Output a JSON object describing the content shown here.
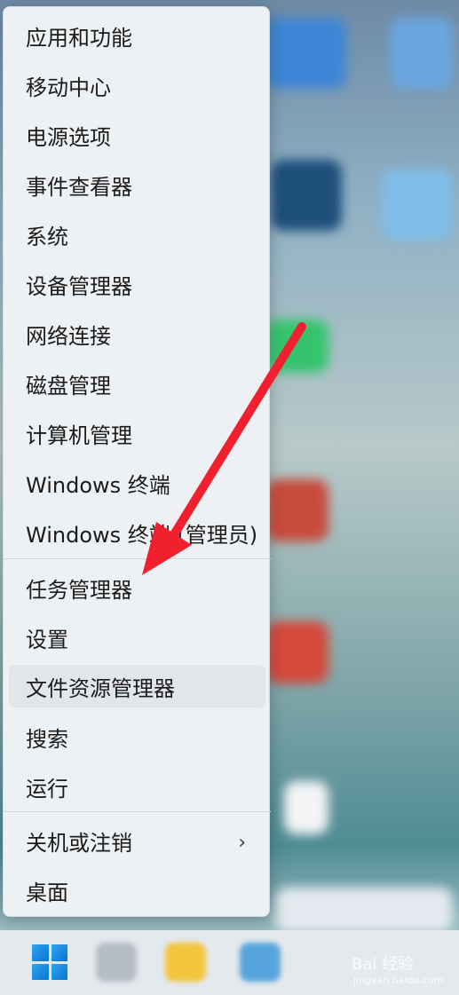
{
  "menu": {
    "items": [
      {
        "label": "应用和功能"
      },
      {
        "label": "移动中心"
      },
      {
        "label": "电源选项"
      },
      {
        "label": "事件查看器"
      },
      {
        "label": "系统"
      },
      {
        "label": "设备管理器"
      },
      {
        "label": "网络连接"
      },
      {
        "label": "磁盘管理"
      },
      {
        "label": "计算机管理"
      },
      {
        "label": "Windows 终端"
      },
      {
        "label": "Windows 终端 (管理员)"
      },
      {
        "label": "任务管理器"
      },
      {
        "label": "设置"
      },
      {
        "label": "文件资源管理器"
      },
      {
        "label": "搜索"
      },
      {
        "label": "运行"
      },
      {
        "label": "关机或注销"
      },
      {
        "label": "桌面"
      }
    ],
    "submenu_indicator": "›"
  },
  "taskbar": {
    "start_icon": "windows-logo-icon",
    "icons": [
      "search-icon",
      "file-explorer-icon",
      "edge-icon"
    ]
  },
  "watermark": {
    "text": "Bai 经验",
    "sub": "jingyan.baidu.com"
  },
  "annotation": {
    "arrow_color": "#f0202e"
  }
}
